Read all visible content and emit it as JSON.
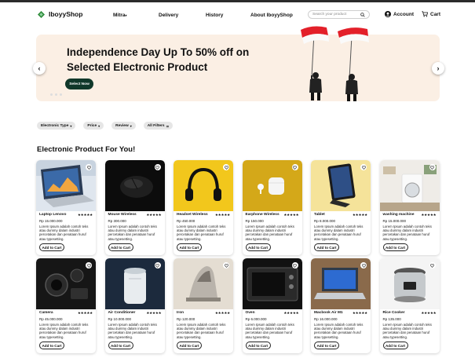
{
  "brand": {
    "name": "IboyyShop",
    "color": "#2e8b3a"
  },
  "nav": {
    "links": [
      {
        "label": "Mitra",
        "has_dropdown": true
      },
      {
        "label": "Delivery",
        "has_dropdown": false
      },
      {
        "label": "History",
        "has_dropdown": false
      },
      {
        "label": "About IboyyShop",
        "has_dropdown": false
      }
    ],
    "search_placeholder": "Search your product",
    "account_label": "Account",
    "cart_label": "Cart"
  },
  "hero": {
    "title": "Independence Day Up To 50% off on Selected Electronic Product",
    "button_label": "Select Now",
    "background": "#fbefe4",
    "button_color": "#10382a",
    "slide_dots": 3,
    "prev_icon": "chevron-left-icon",
    "next_icon": "chevron-right-icon"
  },
  "filters": [
    {
      "label": "Electronic Type"
    },
    {
      "label": "Price"
    },
    {
      "label": "Review"
    },
    {
      "label": "All Filters"
    }
  ],
  "section_title": "Electronic Product For You!",
  "products": [
    {
      "name": "Laptop Lenovo",
      "price": "Rp 15.000.000",
      "rating": "★★★★★",
      "description": "Lorem Ipsum adalah contoh teks atau dummy dalam industri percetakan dan penataan huruf atau typesetting.",
      "button": "Add to Cart",
      "image": "laptop"
    },
    {
      "name": "Mouse Wireless",
      "price": "Rp 300.000",
      "rating": "★★★★★",
      "description": "Lorem Ipsum adalah contoh teks atau dummy dalam industri percetakan dan penataan huruf atau typesetting.",
      "button": "Add to Cart",
      "image": "mouse"
    },
    {
      "name": "Headset Wireless",
      "price": "Rp 450.000",
      "rating": "★★★★★",
      "description": "Lorem Ipsum adalah contoh teks atau dummy dalam industri percetakan dan penataan huruf atau typesetting.",
      "button": "Add to Cart",
      "image": "headset"
    },
    {
      "name": "Earphone Wireless",
      "price": "Rp 150.000",
      "rating": "★★★★★",
      "description": "Lorem Ipsum adalah contoh teks atau dummy dalam industri percetakan dan penataan huruf atau typesetting.",
      "button": "Add to Cart",
      "image": "earphone"
    },
    {
      "name": "Tablet",
      "price": "Rp 8.000.000",
      "rating": "★★★★★",
      "description": "Lorem Ipsum adalah contoh teks atau dummy dalam industri percetakan dan penataan huruf atau typesetting.",
      "button": "Add to Cart",
      "image": "tablet"
    },
    {
      "name": "washing machine",
      "price": "Rp 15.000.000",
      "rating": "★★★★★",
      "description": "Lorem Ipsum adalah contoh teks atau dummy dalam industri percetakan dan penataan huruf atau typesetting.",
      "button": "Add to Cart",
      "image": "washer"
    },
    {
      "name": "Camera",
      "price": "Rp 45.000.000",
      "rating": "★★★★★",
      "description": "Lorem Ipsum adalah contoh teks atau dummy dalam industri percetakan dan penataan huruf atau typesetting.",
      "button": "Add to Cart",
      "image": "camera"
    },
    {
      "name": "Air Conditioner",
      "price": "Rp 10.000.000",
      "rating": "★★★★★",
      "description": "Lorem Ipsum adalah contoh teks atau dummy dalam industri percetakan dan penataan huruf atau typesetting.",
      "button": "Add to Cart",
      "image": "aircon"
    },
    {
      "name": "Iron",
      "price": "Rp 120.000",
      "rating": "★★★★★",
      "description": "Lorem Ipsum adalah contoh teks atau dummy dalam industri percetakan dan penataan huruf atau typesetting.",
      "button": "Add to Cart",
      "image": "iron"
    },
    {
      "name": "Oven",
      "price": "Rp 6.000.000",
      "rating": "★★★★★",
      "description": "Lorem Ipsum adalah contoh teks atau dummy dalam industri percetakan dan penataan huruf atau typesetting.",
      "button": "Add to Cart",
      "image": "oven"
    },
    {
      "name": "Macbook Air M1",
      "price": "Rp 16.000.000",
      "rating": "★★★★★",
      "description": "Lorem Ipsum adalah contoh teks atau dummy dalam industri percetakan dan penataan huruf atau typesetting.",
      "button": "Add to Cart",
      "image": "macbook"
    },
    {
      "name": "Rice Cooker",
      "price": "Rp 135.000",
      "rating": "★★★★★",
      "description": "Lorem Ipsum adalah contoh teks atau dummy dalam industri percetakan dan penataan huruf atau typesetting.",
      "button": "Add to Cart",
      "image": "ricecooker"
    }
  ]
}
